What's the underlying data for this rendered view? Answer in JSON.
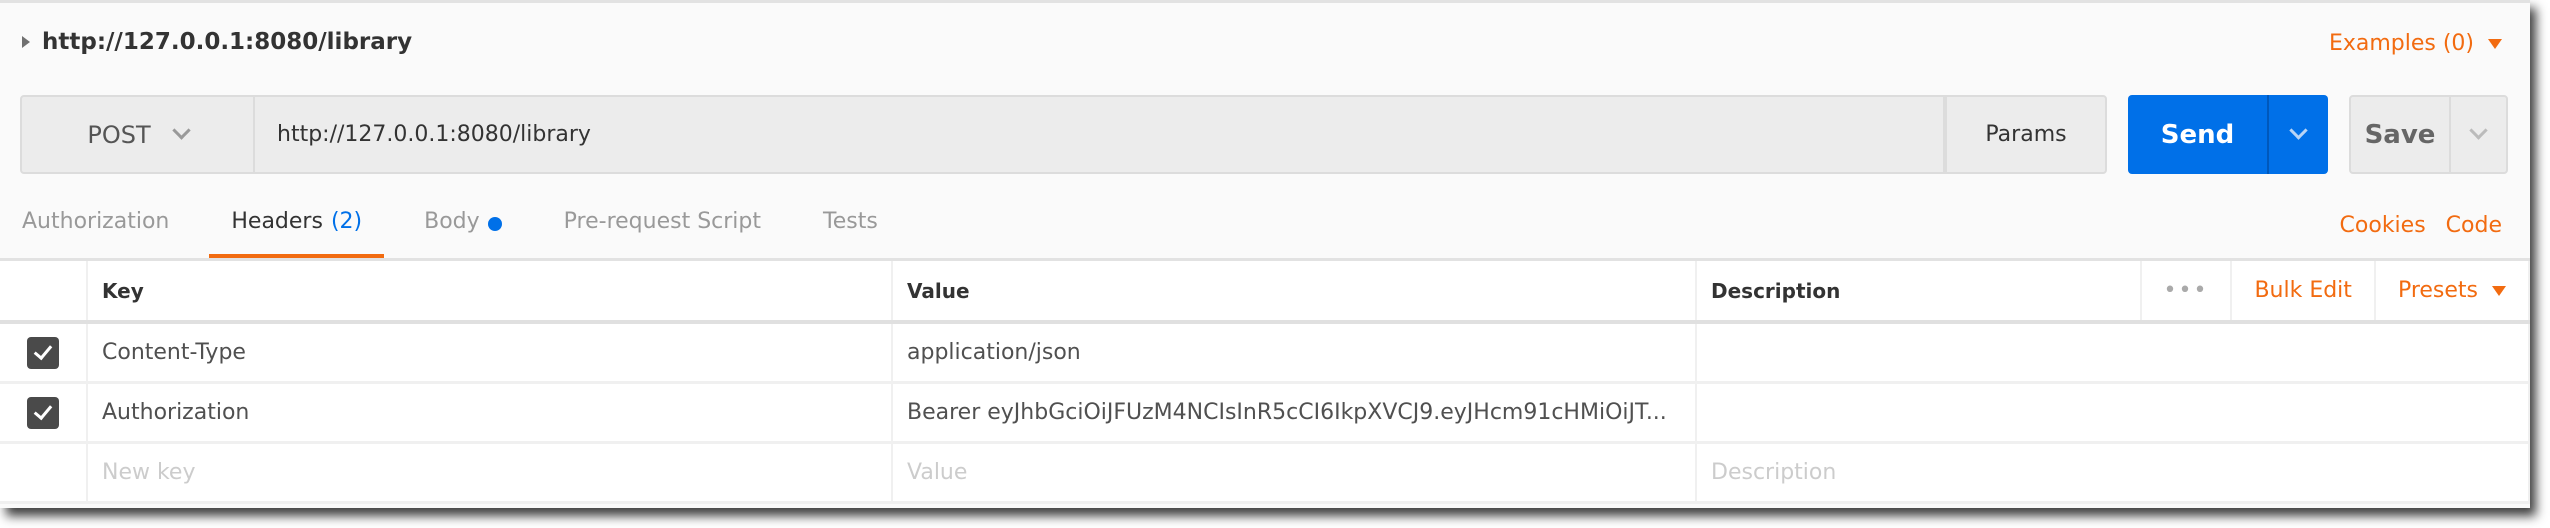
{
  "request": {
    "title": "http://127.0.0.1:8080/library",
    "examples_label": "Examples (0)",
    "method": "POST",
    "url": "http://127.0.0.1:8080/library",
    "params_label": "Params",
    "send_label": "Send",
    "save_label": "Save"
  },
  "tabs": [
    {
      "label": "Authorization"
    },
    {
      "label": "Headers",
      "count": "(2)"
    },
    {
      "label": "Body"
    },
    {
      "label": "Pre-request Script"
    },
    {
      "label": "Tests"
    }
  ],
  "active_tab": "Headers",
  "links": {
    "cookies": "Cookies",
    "code": "Code"
  },
  "headers_table": {
    "columns": {
      "key": "Key",
      "value": "Value",
      "description": "Description"
    },
    "more_label": "•••",
    "bulk_edit_label": "Bulk Edit",
    "presets_label": "Presets",
    "rows": [
      {
        "checked": true,
        "key": "Content-Type",
        "value": "application/json",
        "description": ""
      },
      {
        "checked": true,
        "key": "Authorization",
        "value": "Bearer eyJhbGciOiJFUzM4NCIsInR5cCI6IkpXVCJ9.eyJHcm91cHMiOiJT...",
        "description": ""
      }
    ],
    "placeholders": {
      "key": "New key",
      "value": "Value",
      "description": "Description"
    }
  },
  "colors": {
    "accent": "#f26b10",
    "send": "#0070e8"
  }
}
